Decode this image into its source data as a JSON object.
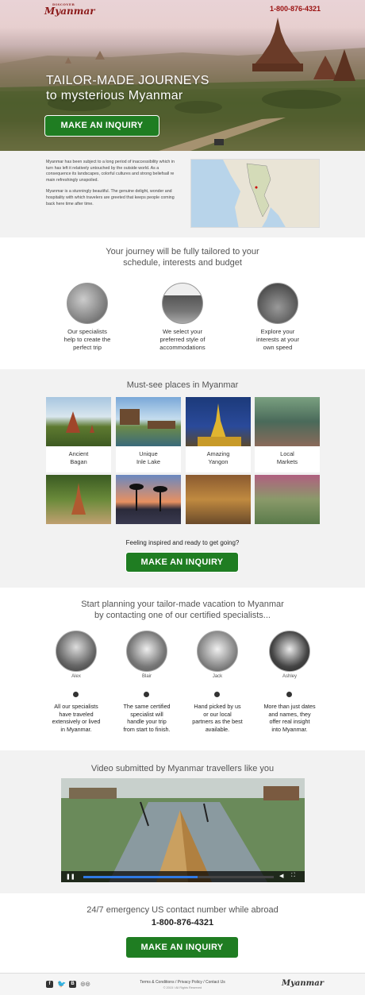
{
  "brand": {
    "logo_text": "Myanmar",
    "logo_sub": "DISCOVER",
    "phone": "1-800-876-4321"
  },
  "hero": {
    "title_line1": "TAILOR-MADE JOURNEYS",
    "title_line2": "to mysterious Myanmar",
    "cta": "MAKE AN INQUIRY"
  },
  "intro": {
    "para1": "Myanmar has been subject to a long period of inaccessibility which in turn has left it relatively untouched by the outside world. As a consequence its landscapes, colorful cultures and strong beliefsall re main refreshingly unspoiled.",
    "para2": "Myanmar is a stunningly beautiful. The genuine delight, wonder and hospitality with which travelers are greeted that keeps people coming back here time after time."
  },
  "tailored": {
    "heading_line1": "Your journey will be fully tailored to your",
    "heading_line2": "schedule, interests and budget",
    "items": [
      {
        "text1": "Our specialists",
        "text2": "help to create the",
        "text3": "perfect trip"
      },
      {
        "text1": "We select your",
        "text2": "preferred style of",
        "text3": "accommodations"
      },
      {
        "text1": "Explore your",
        "text2": "interests at your",
        "text3": "own speed"
      }
    ]
  },
  "places": {
    "heading": "Must-see places in Myanmar",
    "items": [
      {
        "line1": "Ancient",
        "line2": "Bagan"
      },
      {
        "line1": "Unique",
        "line2": "Inle Lake"
      },
      {
        "line1": "Amazing",
        "line2": "Yangon"
      },
      {
        "line1": "Local",
        "line2": "Markets"
      }
    ],
    "prompt": "Feeling inspired and ready to get going?",
    "cta": "MAKE AN INQUIRY"
  },
  "specialists": {
    "heading_line1": "Start planning your tailor-made vacation to Myanmar",
    "heading_line2": "by contacting one of our certified specialists...",
    "people": [
      {
        "name": "Alex",
        "d1": "All our specialists",
        "d2": "have traveled",
        "d3": "extensively or lived",
        "d4": "in Myanmar."
      },
      {
        "name": "Blair",
        "d1": "The same certified",
        "d2": "specialist will",
        "d3": "handle your trip",
        "d4": "from start to finish."
      },
      {
        "name": "Jack",
        "d1": "Hand picked by us",
        "d2": "or our local",
        "d3": "partners as the best",
        "d4": "available."
      },
      {
        "name": "Ashley",
        "d1": "More than just dates",
        "d2": "and names, they",
        "d3": "offer real insight",
        "d4": "into Myanmar."
      }
    ]
  },
  "video": {
    "heading": "Video submitted by Myanmar travellers like you",
    "progress": 0.6
  },
  "emergency": {
    "text": "24/7 emergency US contact number while abroad",
    "phone": "1-800-876-4321",
    "cta": "MAKE AN INQUIRY"
  },
  "footer": {
    "links": "Terms & Conditions / Privacy Policy / Contact Us",
    "copyright": "© 2015 / All Rights Reserved",
    "logo_text": "Myanmar",
    "icons": [
      "facebook-icon",
      "twitter-icon",
      "blog-icon",
      "tripadvisor-icon"
    ]
  },
  "colors": {
    "accent": "#1f7d22",
    "brand": "#9a1010"
  }
}
